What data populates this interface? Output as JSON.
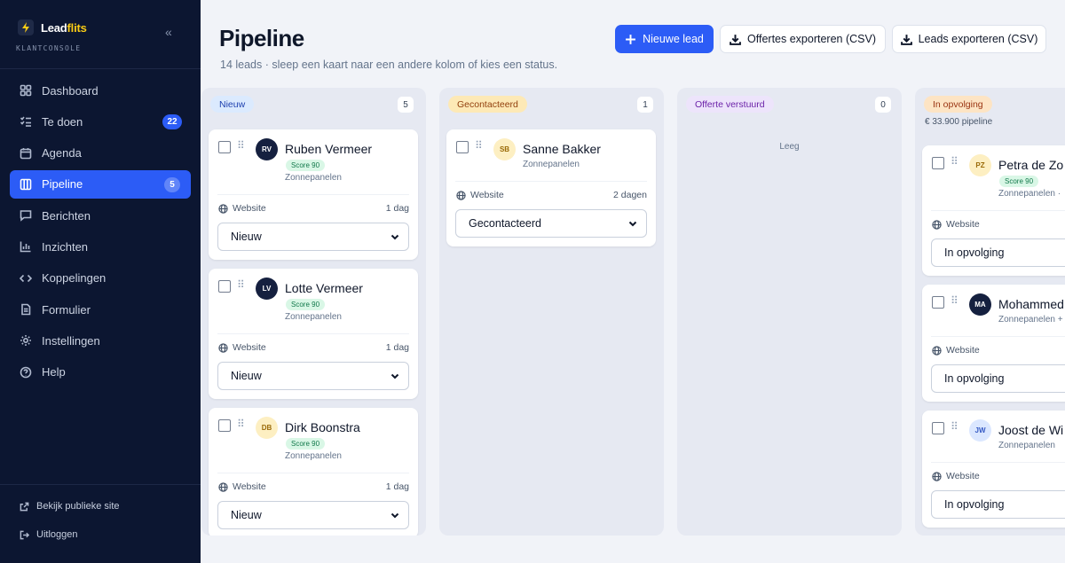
{
  "app": {
    "brand_prefix": "Lead",
    "brand_suffix": "flits",
    "console_label": "KLANTCONSOLE",
    "logo_icon": "bolt-icon"
  },
  "sidebar": {
    "items": [
      {
        "label": "Dashboard",
        "icon": "home-icon"
      },
      {
        "label": "Te doen",
        "icon": "checklist-icon",
        "badge": "22"
      },
      {
        "label": "Agenda",
        "icon": "calendar-icon"
      },
      {
        "label": "Pipeline",
        "icon": "columns-icon",
        "badge": "5",
        "active": true
      },
      {
        "label": "Berichten",
        "icon": "message-icon"
      },
      {
        "label": "Inzichten",
        "icon": "chart-icon"
      },
      {
        "label": "Koppelingen",
        "icon": "code-icon"
      },
      {
        "label": "Formulier",
        "icon": "document-icon"
      },
      {
        "label": "Instellingen",
        "icon": "gear-icon"
      },
      {
        "label": "Help",
        "icon": "help-icon"
      }
    ],
    "footer": {
      "public_site": "Bekijk publieke site",
      "logout": "Uitloggen"
    }
  },
  "header": {
    "title": "Pipeline",
    "subtitle": "14 leads · sleep een kaart naar een andere kolom of kies een status.",
    "new_lead": "Nieuwe lead",
    "export_quotes": "Offertes exporteren (CSV)",
    "export_leads": "Leads exporteren (CSV)"
  },
  "colors": {
    "primary": "#2c5cf6",
    "sidebar_bg": "#0c1631",
    "status_new": "#dbeafe",
    "status_contacted": "#fde9b6",
    "status_quote": "#ede4fb",
    "status_followup": "#fde4c4"
  },
  "columns": [
    {
      "label": "Nieuw",
      "count": "5",
      "cards": [
        {
          "initials": "RV",
          "name": "Ruben Vermeer",
          "score": "Score 90",
          "product": "Zonnepanelen",
          "source": "Website",
          "age": "1 dag",
          "status": "Nieuw"
        },
        {
          "initials": "LV",
          "name": "Lotte Vermeer",
          "score": "Score 90",
          "product": "Zonnepanelen",
          "source": "Website",
          "age": "1 dag",
          "status": "Nieuw"
        },
        {
          "initials": "DB",
          "name": "Dirk Boonstra",
          "score": "Score 90",
          "product": "Zonnepanelen",
          "source": "Website",
          "age": "1 dag",
          "status": "Nieuw"
        }
      ]
    },
    {
      "label": "Gecontacteerd",
      "count": "1",
      "cards": [
        {
          "initials": "SB",
          "name": "Sanne Bakker",
          "product": "Zonnepanelen",
          "source": "Website",
          "age": "2 dagen",
          "status": "Gecontacteerd"
        }
      ]
    },
    {
      "label": "Offerte verstuurd",
      "count": "0",
      "empty": "Leeg"
    },
    {
      "label": "In opvolging",
      "meta": "€ 33.900 pipeline",
      "cards": [
        {
          "initials": "PZ",
          "name": "Petra de Zo",
          "score": "Score 90",
          "product": "Zonnepanelen ·",
          "source": "Website",
          "status": "In opvolging"
        },
        {
          "initials": "MA",
          "name": "Mohammed",
          "product": "Zonnepanelen +",
          "source": "Website",
          "status": "In opvolging"
        },
        {
          "initials": "JW",
          "name": "Joost de Wi",
          "product": "Zonnepanelen",
          "source": "Website",
          "status": "In opvolging"
        }
      ]
    }
  ]
}
